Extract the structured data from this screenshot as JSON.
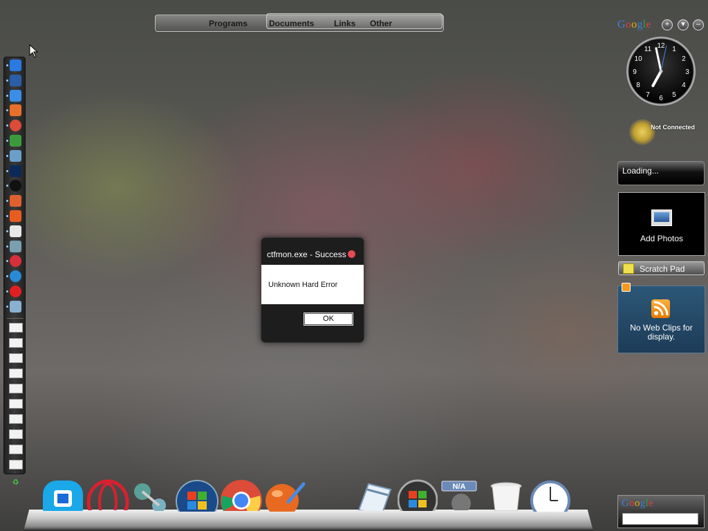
{
  "top_menu": {
    "programs": "Programs",
    "documents": "Documents",
    "links": "Links",
    "other": "Other"
  },
  "left_dock": {
    "app_icons": [
      {
        "name": "computer-icon",
        "color": "#2a7ae2"
      },
      {
        "name": "rocket-icon",
        "color": "#2a5fa8"
      },
      {
        "name": "folder-icon",
        "color": "#3a8ee8"
      },
      {
        "name": "firefox-icon",
        "color": "#e8702a"
      },
      {
        "name": "chrome-icon",
        "color": "#dd4b39"
      },
      {
        "name": "utorrent-icon",
        "color": "#3c9a3c"
      },
      {
        "name": "image-viewer-icon",
        "color": "#6aa0c8"
      },
      {
        "name": "photoshop-icon",
        "color": "#0b2a5a"
      },
      {
        "name": "circle-app-icon",
        "color": "#111111"
      },
      {
        "name": "paint-icon",
        "color": "#e06030"
      },
      {
        "name": "office-icon",
        "color": "#e85c20"
      },
      {
        "name": "blank-app-icon",
        "color": "#e8e8e8"
      },
      {
        "name": "network-icon",
        "color": "#7aa0b0"
      },
      {
        "name": "opera-icon",
        "color": "#d8303a"
      },
      {
        "name": "safari-icon",
        "color": "#2a8ad8"
      },
      {
        "name": "opera-red-icon",
        "color": "#e02020"
      },
      {
        "name": "preview-icon",
        "color": "#8ab0d0"
      }
    ],
    "window_thumbnails": 10
  },
  "dialog": {
    "title": "ctfmon.exe - Success",
    "message": "Unknown Hard Error",
    "ok_label": "OK"
  },
  "gadgets": {
    "google_brand": [
      "G",
      "o",
      "o",
      "g",
      "l",
      "e"
    ],
    "clock": {
      "hour": 6,
      "minute": 58,
      "second": 2,
      "numbers": [
        "12",
        "1",
        "2",
        "3",
        "4",
        "5",
        "6",
        "7",
        "8",
        "9",
        "10",
        "11"
      ]
    },
    "network_status": "Not Connected",
    "loading": "Loading...",
    "photos_label": "Add Photos",
    "scratch_pad": "Scratch Pad",
    "web_clips": "No Web Clips for display."
  },
  "bottom_dock": [
    "app-store-icon",
    "opera-icon",
    "network-icon",
    "windows-start-icon",
    "chrome-icon",
    "paint-icon",
    "notepad-icon",
    "windows-update-icon",
    "weather-na-icon",
    "trash-icon",
    "clock-icon"
  ],
  "colors": {
    "accent_blue": "#2a7ae2",
    "dialog_close": "#e84a55",
    "rss_orange": "#f39a1e"
  }
}
